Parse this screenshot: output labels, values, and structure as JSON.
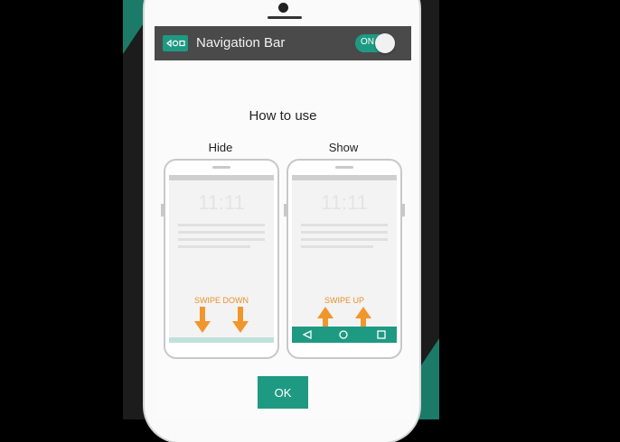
{
  "app_bar": {
    "title": "Navigation Bar",
    "toggle_label": "ON",
    "icon": "navigation-bar-icon",
    "accent": "#1e9a82"
  },
  "dialog": {
    "title": "How to use",
    "hide": {
      "title": "Hide",
      "clock": "11:11",
      "instruction": "SWIPE DOWN"
    },
    "show": {
      "title": "Show",
      "clock": "11:11",
      "instruction": "SWIPE UP"
    },
    "ok_label": "OK"
  }
}
